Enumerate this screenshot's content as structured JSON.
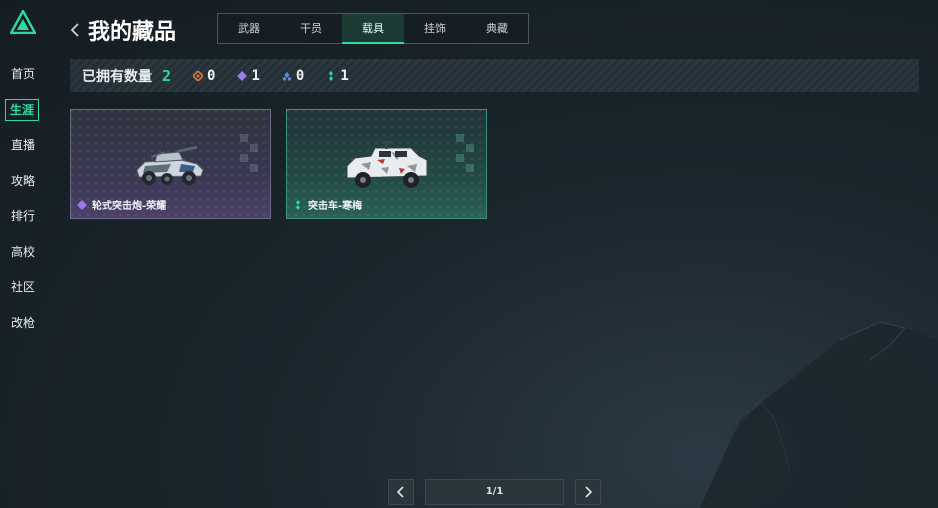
{
  "nav": {
    "items": [
      {
        "label": "首页",
        "active": false
      },
      {
        "label": "生涯",
        "active": true
      },
      {
        "label": "直播",
        "active": false
      },
      {
        "label": "攻略",
        "active": false
      },
      {
        "label": "排行",
        "active": false
      },
      {
        "label": "高校",
        "active": false
      },
      {
        "label": "社区",
        "active": false
      },
      {
        "label": "改枪",
        "active": false
      }
    ]
  },
  "header": {
    "title": "我的藏品",
    "tabs": [
      {
        "label": "武器",
        "active": false
      },
      {
        "label": "干员",
        "active": false
      },
      {
        "label": "载具",
        "active": true
      },
      {
        "label": "挂饰",
        "active": false
      },
      {
        "label": "典藏",
        "active": false
      }
    ]
  },
  "stats": {
    "owned_label": "已拥有数量",
    "owned_count": "2",
    "rarities": [
      {
        "icon": "orange-gem-icon",
        "color": "#e07a3e",
        "count": "0"
      },
      {
        "icon": "purple-gem-icon",
        "color": "#9b7be8",
        "count": "1"
      },
      {
        "icon": "blue-gem-icon",
        "color": "#5a8fe0",
        "count": "0"
      },
      {
        "icon": "green-gem-icon",
        "color": "#2ed9a0",
        "count": "1"
      }
    ]
  },
  "items": [
    {
      "name": "轮式突击炮-荣耀",
      "rarity": "purple",
      "icon": "purple-gem-icon"
    },
    {
      "name": "突击车-寒梅",
      "rarity": "teal",
      "icon": "green-gem-icon"
    }
  ],
  "pagination": {
    "page_text": "1/1",
    "current_page": 1,
    "total_pages": 1
  },
  "colors": {
    "accent": "#2ed9a0",
    "background": "#1a252c"
  }
}
